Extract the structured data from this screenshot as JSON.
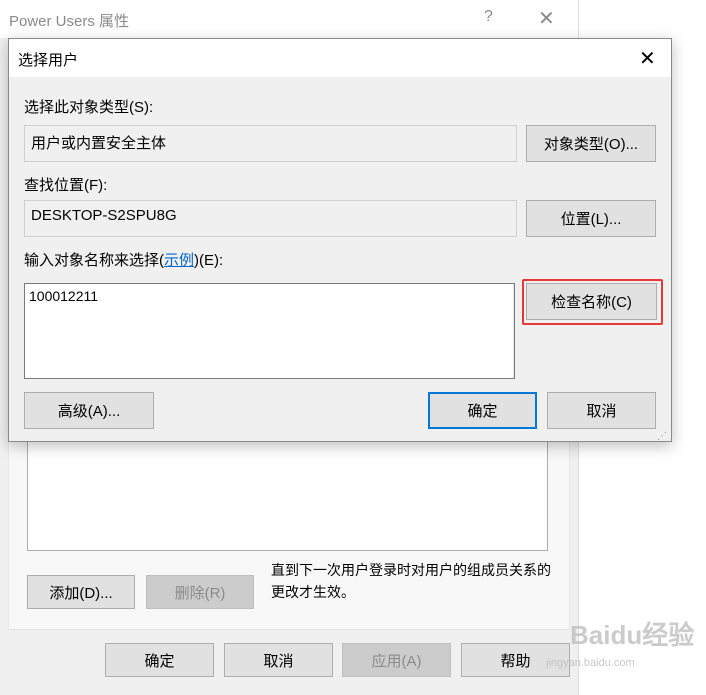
{
  "background_dialog": {
    "title": "Power Users 属性",
    "help_glyph": "?",
    "close_glyph": "✕",
    "note": "直到下一次用户登录时对用户的组成员关系的更改才生效。",
    "add_button": "添加(D)...",
    "remove_button": "删除(R)",
    "ok_button": "确定",
    "cancel_button": "取消",
    "apply_button": "应用(A)",
    "help_button": "帮助"
  },
  "select_users_dialog": {
    "title": "选择用户",
    "close_glyph": "✕",
    "object_type_label": "选择此对象类型(S):",
    "object_type_value": "用户或内置安全主体",
    "object_types_button": "对象类型(O)...",
    "location_label": "查找位置(F):",
    "location_value": "DESKTOP-S2SPU8G",
    "locations_button": "位置(L)...",
    "names_label_prefix": "输入对象名称来选择(",
    "names_label_link": "示例",
    "names_label_suffix": ")(E):",
    "names_value": "100012211",
    "check_names_button": "检查名称(C)",
    "advanced_button": "高级(A)...",
    "ok_button": "确定",
    "cancel_button": "取消"
  },
  "highlight_color": "#e53935",
  "watermark": {
    "text": "Baidu经验",
    "sub": "jingyan.baidu.com"
  }
}
